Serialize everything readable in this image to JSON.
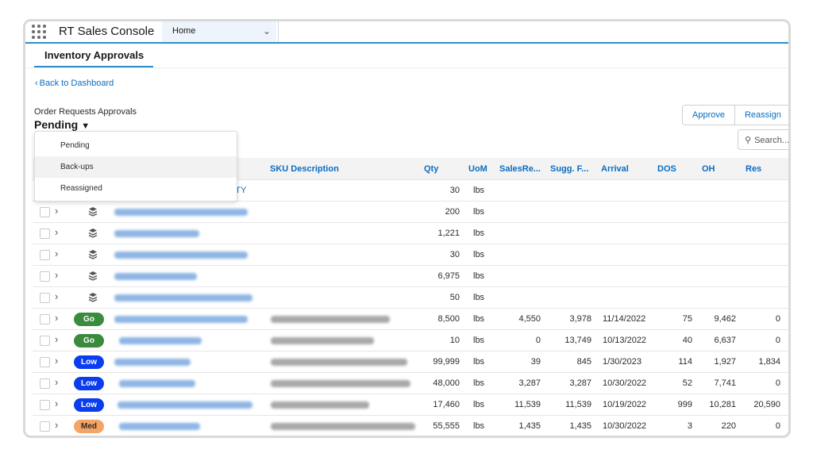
{
  "app": {
    "name": "RT Sales Console",
    "launcher_icon": "app-launcher-grid-icon"
  },
  "tabs": {
    "home": "Home",
    "chevron_icon": "chevron-down-icon"
  },
  "subtab": {
    "label": "Inventory Approvals"
  },
  "nav": {
    "back_label": "Back to Dashboard"
  },
  "view": {
    "label": "Order Requests Approvals",
    "selected": "Pending"
  },
  "actions": {
    "approve": "Approve",
    "reassign": "Reassign"
  },
  "search": {
    "placeholder": "Search..."
  },
  "dropdown": {
    "options": [
      "Pending",
      "Back-ups",
      "Reassigned"
    ],
    "hovered": "Back-ups"
  },
  "table": {
    "columns": [
      "SKU Description",
      "Qty",
      "UoM",
      "SalesRe...",
      "Sugg. F...",
      "Arrival",
      "DOS",
      "OH",
      "Res"
    ],
    "first_row_partial_text": "LTY",
    "rows": [
      {
        "status": "",
        "qty": "30",
        "uom": "lbs"
      },
      {
        "status": "stack",
        "qty": "200",
        "uom": "lbs"
      },
      {
        "status": "stack",
        "qty": "1,221",
        "uom": "lbs"
      },
      {
        "status": "stack",
        "qty": "30",
        "uom": "lbs"
      },
      {
        "status": "stack",
        "qty": "6,975",
        "uom": "lbs"
      },
      {
        "status": "stack",
        "qty": "50",
        "uom": "lbs"
      },
      {
        "status": "Go",
        "qty": "8,500",
        "uom": "lbs",
        "sales": "4,550",
        "sugg": "3,978",
        "arrival": "11/14/2022",
        "dos": "75",
        "oh": "9,462",
        "res": "0"
      },
      {
        "status": "Go",
        "qty": "10",
        "uom": "lbs",
        "sales": "0",
        "sugg": "13,749",
        "arrival": "10/13/2022",
        "dos": "40",
        "oh": "6,637",
        "res": "0"
      },
      {
        "status": "Low",
        "qty": "99,999",
        "uom": "lbs",
        "sales": "39",
        "sugg": "845",
        "arrival": "1/30/2023",
        "dos": "114",
        "oh": "1,927",
        "res": "1,834"
      },
      {
        "status": "Low",
        "qty": "48,000",
        "uom": "lbs",
        "sales": "3,287",
        "sugg": "3,287",
        "arrival": "10/30/2022",
        "dos": "52",
        "oh": "7,741",
        "res": "0"
      },
      {
        "status": "Low",
        "qty": "17,460",
        "uom": "lbs",
        "sales": "11,539",
        "sugg": "11,539",
        "arrival": "10/19/2022",
        "dos": "999",
        "oh": "10,281",
        "res": "20,590"
      },
      {
        "status": "Med",
        "qty": "55,555",
        "uom": "lbs",
        "sales": "1,435",
        "sugg": "1,435",
        "arrival": "10/30/2022",
        "dos": "3",
        "oh": "220",
        "res": "0"
      }
    ]
  },
  "colors": {
    "accent": "#0b6cbf",
    "tab_underline": "#2d8ec9",
    "go": "#3b8b3f",
    "low": "#0b3df0",
    "med": "#f4a464"
  }
}
